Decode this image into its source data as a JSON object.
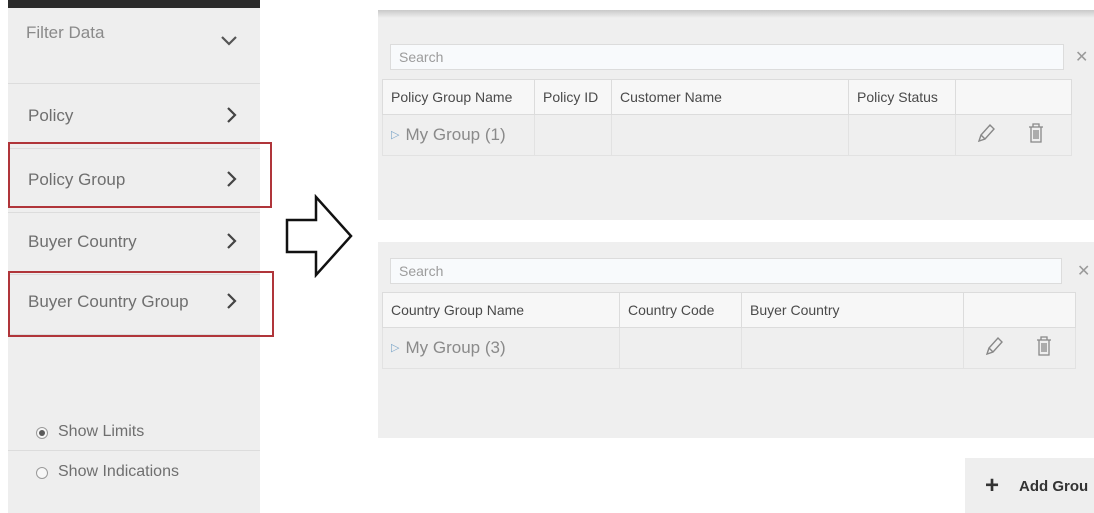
{
  "sidebar": {
    "filter_label": "Filter Data",
    "items": [
      {
        "label": "Policy"
      },
      {
        "label": "Policy Group"
      },
      {
        "label": "Buyer Country"
      },
      {
        "label": "Buyer Country Group"
      }
    ],
    "options": [
      {
        "label": "Show Limits",
        "selected": true
      },
      {
        "label": "Show Indications",
        "selected": false
      }
    ]
  },
  "policy_group_panel": {
    "search_placeholder": "Search",
    "columns": [
      "Policy Group Name",
      "Policy ID",
      "Customer Name",
      "Policy Status",
      ""
    ],
    "rows": [
      {
        "name": "My Group (1)",
        "policy_id": "",
        "customer_name": "",
        "policy_status": ""
      }
    ]
  },
  "country_group_panel": {
    "search_placeholder": "Search",
    "columns": [
      "Country Group Name",
      "Country Code",
      "Buyer Country",
      ""
    ],
    "rows": [
      {
        "name": "My Group (3)",
        "country_code": "",
        "buyer_country": ""
      }
    ]
  },
  "add_group": {
    "label": "Add Grou"
  },
  "icons": {
    "filter_toggle": "chevron-down-icon",
    "nav_arrow": "chevron-right-icon",
    "clear": "close-icon",
    "edit": "pencil-icon",
    "delete": "trash-icon",
    "expand": "triangle-right-icon",
    "add": "plus-icon",
    "flow": "arrow-right-outline-icon"
  },
  "colors": {
    "highlight": "#b0353a",
    "sidebar_bg": "#eeeeee",
    "panel_bg": "#efefef"
  }
}
